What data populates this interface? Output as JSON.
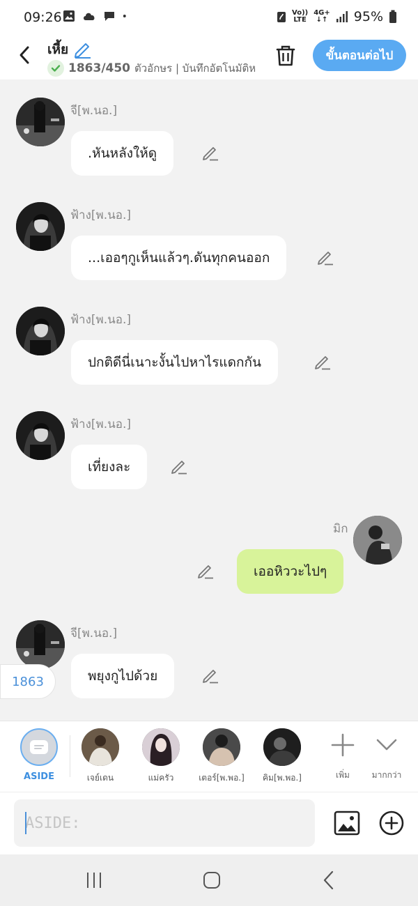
{
  "status": {
    "time": "09:26",
    "net_top": "Vo))",
    "net_bottom": "LTE",
    "gen": "4G+",
    "battery": "95%"
  },
  "header": {
    "title": "เหี้ย",
    "count": "1863/450",
    "note": "ตัวอักษร | บันทึกอัตโนมัติห",
    "next_label": "ขั้นตอนต่อไป"
  },
  "messages": [
    {
      "sender": "จี[พ.นอ.]",
      "text": ".หันหลังให้ดู",
      "mine": false
    },
    {
      "sender": "ฟ้าง[พ.นอ.]",
      "text": "...เออๆกูเห็นแล้วๆ.ดันทุกคนออก",
      "mine": false
    },
    {
      "sender": "ฟ้าง[พ.นอ.]",
      "text": "ปกติดีนี่เนาะงั้นไปหาไรแดกกัน",
      "mine": false
    },
    {
      "sender": "ฟ้าง[พ.นอ.]",
      "text": "เที่ยงละ",
      "mine": false
    },
    {
      "sender": "มิก",
      "text": "เออหิววะไปๆ",
      "mine": true
    },
    {
      "sender": "จี[พ.นอ.]",
      "text": "พยุงกูไปด้วย",
      "mine": false
    }
  ],
  "counter_pill": "1863",
  "characters": [
    {
      "name": "ASIDE"
    },
    {
      "name": "เจย์เดน"
    },
    {
      "name": "แม่ครัว"
    },
    {
      "name": "เตอร์[พ.พอ.]"
    },
    {
      "name": "คิม[พ.พอ.]"
    }
  ],
  "tools": {
    "add_label": "เพิ่ม",
    "more_label": "มากกว่า"
  },
  "input": {
    "placeholder": "ASIDE:"
  },
  "colors": {
    "accent": "#5aaaf2",
    "mine_bubble": "#d8f39a",
    "background": "#f2f2f2"
  }
}
